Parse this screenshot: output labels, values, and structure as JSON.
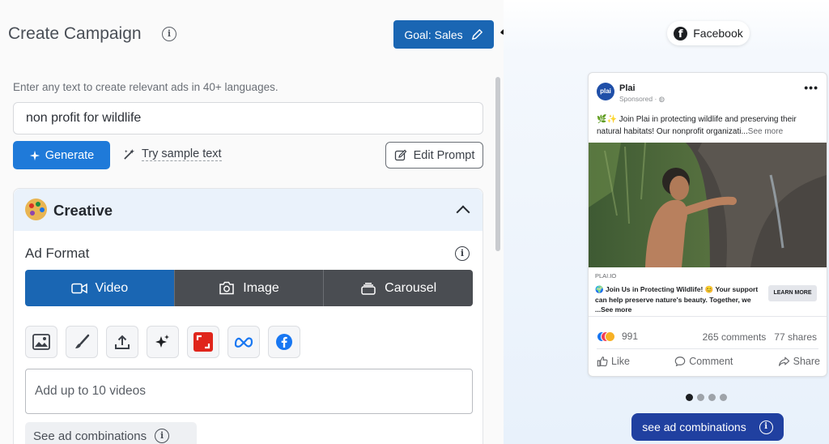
{
  "header": {
    "title": "Create Campaign",
    "info_glyph": "i",
    "goal_label": "Goal: Sales"
  },
  "prompt": {
    "hint": "Enter any text to create relevant ads in 40+ languages.",
    "value": "non profit for wildlife",
    "generate_label": "Generate",
    "try_label": "Try sample text",
    "edit_label": "Edit Prompt"
  },
  "creative": {
    "title": "Creative",
    "ad_format_label": "Ad Format",
    "formats": [
      {
        "label": "Video",
        "active": true
      },
      {
        "label": "Image",
        "active": false
      },
      {
        "label": "Carousel",
        "active": false
      }
    ],
    "source_icons": [
      "image-icon",
      "brush-icon",
      "upload-icon",
      "sparkle-icon",
      "crop-icon",
      "meta-icon",
      "facebook-icon"
    ],
    "videos_placeholder": "Add up to 10 videos",
    "see_combos_label": "See ad combinations"
  },
  "preview": {
    "platform_label": "Facebook",
    "page_name": "Plai",
    "avatar_text": "plai",
    "sponsored": "Sponsored · ",
    "caption": "🌿✨ Join Plai in protecting wildlife and preserving their natural habitats! Our nonprofit organizati...",
    "caption_more": "See more",
    "domain": "PLAI.IO",
    "link_text": "🌍 Join Us in Protecting Wildlife! 😊 Your support can help preserve nature's beauty. Together, we ...",
    "link_more": "See more",
    "cta": "LEARN MORE",
    "reactions": "991",
    "comments": "265 comments",
    "shares": "77 shares",
    "like": "Like",
    "comment": "Comment",
    "share": "Share",
    "see_combos_label": "see ad combinations"
  },
  "colors": {
    "primary": "#1a66b3",
    "generate": "#1f7ad9",
    "format_inactive": "#4a4d52",
    "see_combos": "#2040a0"
  }
}
